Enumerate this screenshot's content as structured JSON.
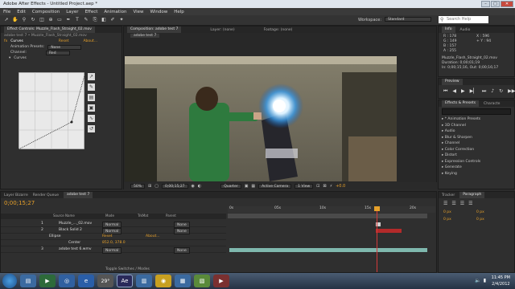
{
  "window": {
    "title": "Adobe After Effects - Untitled Project.aep *",
    "min": "–",
    "max": "□",
    "close": "✕"
  },
  "menu": [
    "File",
    "Edit",
    "Composition",
    "Layer",
    "Effect",
    "Animation",
    "View",
    "Window",
    "Help"
  ],
  "workspace": {
    "label": "Workspace:",
    "value": "Standard"
  },
  "search": {
    "placeholder": "Search Help"
  },
  "effect_controls": {
    "tab": "Effect Controls: Muzzle_Flash_Straight_02.mov",
    "subtitle": "adobe test 7 • Muzzle_Flash_Straight_02.mov",
    "effect_name": "Curves",
    "reset": "Reset",
    "about": "About...",
    "presets_label": "Animation Presets:",
    "presets_value": "None",
    "channel_label": "Channel:",
    "channel_value": "Red",
    "curves_label": "Curves"
  },
  "composition": {
    "tab": "Composition: adobe test 7",
    "layer_tab": "Layer: (none)",
    "footage_tab": "Footage: (none)",
    "sub_tab": "adobe test 7",
    "zoom": "50%",
    "timecode": "0;00;15;27",
    "resolution": "Quarter",
    "camera": "Active Camera",
    "view": "1 View",
    "exposure": "+0.0"
  },
  "info": {
    "tab": "Info",
    "tab2": "Audio",
    "r": "R : 178",
    "g": "G : 149",
    "b": "B : 157",
    "a": "A : 255",
    "x": "X : 596",
    "y": "+ Y : 94",
    "file": "Muzzle_Flash_Straight_02.mov",
    "duration": "Duration: 0;00;01;19",
    "inout": "In: 0;00;15;16, Out: 0;00;16;17"
  },
  "preview": {
    "tab": "Preview"
  },
  "effects": {
    "tab": "Effects & Presets",
    "tab2": "Characte",
    "items": [
      "* Animation Presets",
      "3D Channel",
      "Audio",
      "Blur & Sharpen",
      "Channel",
      "Color Correction",
      "Distort",
      "Expression Controls",
      "Generate",
      "Keying"
    ]
  },
  "tracker": {
    "tab": "Tracker",
    "tab2": "Paragraph",
    "px1": "0 px",
    "px2": "0 px",
    "px3": "0 px",
    "px4": "0 px"
  },
  "timeline": {
    "tabs": [
      "Layer Bizarre",
      "Render Queue",
      "adobe test 7"
    ],
    "timecode": "0;00;15;27",
    "col_source": "Source Name",
    "col_mode": "Mode",
    "col_trkmat": "TrkMat",
    "col_parent": "Parent",
    "rulers": [
      "0s",
      "05s",
      "10s",
      "15s",
      "20s"
    ],
    "layers": [
      {
        "num": "1",
        "name": "Muzzle_..._02.mov",
        "mode": "Normal",
        "parent": "None"
      },
      {
        "num": "2",
        "name": "Black Solid 2",
        "mode": "Normal",
        "parent": "None"
      },
      {
        "num": "",
        "name": "Ellipse",
        "mode": "Reset",
        "parent": "About..."
      },
      {
        "num": "",
        "name": "Center",
        "mode": "852.0, 378.0",
        "parent": ""
      },
      {
        "num": "3",
        "name": "adobe test 6.wmv",
        "mode": "Normal",
        "parent": "None"
      }
    ],
    "footer": "Toggle Switches / Modes"
  },
  "taskbar": {
    "temp": "29°",
    "time": "11:45 PM",
    "date": "2/4/2012"
  },
  "colors": {
    "accent": "#e6a02a",
    "playhead": "#d43a3a",
    "teal_bar": "#7fb8ae",
    "red_bar": "#b32a2a"
  }
}
